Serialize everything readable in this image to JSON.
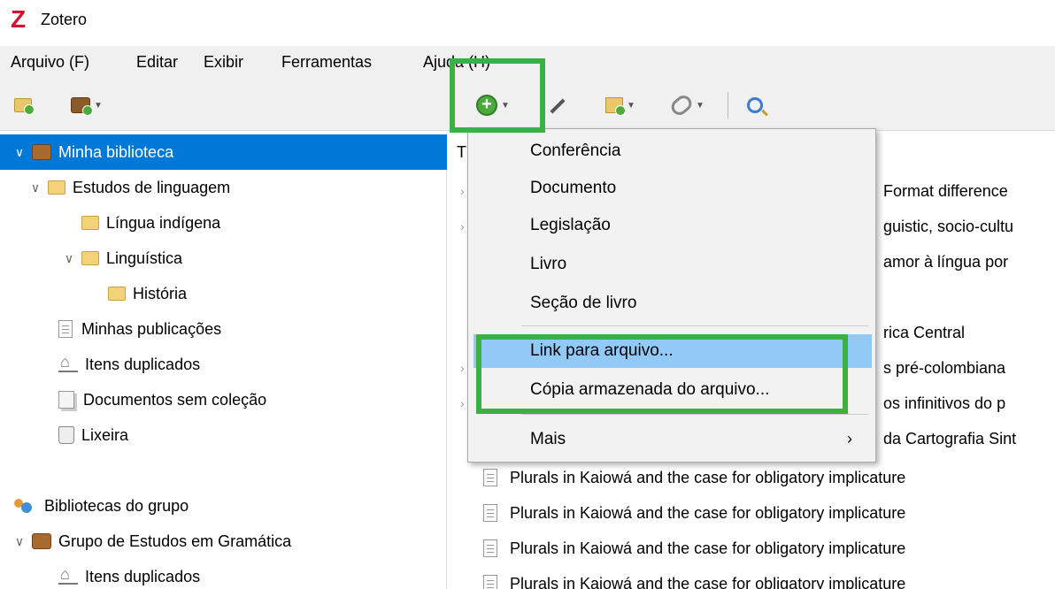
{
  "window": {
    "title": "Zotero",
    "logo": "Z"
  },
  "menubar": {
    "items": [
      "Arquivo (F)",
      "Editar",
      "Exibir",
      "Ferramentas",
      "Ajuda (H)"
    ]
  },
  "toolbar": {
    "buttons": [
      {
        "icon": "new-collection-icon"
      },
      {
        "icon": "new-library-icon"
      },
      {
        "icon": "new-item-icon"
      },
      {
        "icon": "add-by-identifier-icon"
      },
      {
        "icon": "new-note-icon"
      },
      {
        "icon": "add-attachment-icon"
      },
      {
        "icon": "search-icon"
      }
    ]
  },
  "tree": {
    "items": [
      {
        "label": "Minha biblioteca",
        "selected": true
      },
      {
        "label": "Estudos de linguagem"
      },
      {
        "label": "Língua indígena"
      },
      {
        "label": "Linguística"
      },
      {
        "label": "História"
      },
      {
        "label": "Minhas publicações"
      },
      {
        "label": "Itens duplicados"
      },
      {
        "label": "Documentos sem coleção"
      },
      {
        "label": "Lixeira"
      },
      {
        "label": "Bibliotecas do grupo"
      },
      {
        "label": "Grupo de Estudos em Gramática"
      },
      {
        "label": "Itens duplicados"
      }
    ]
  },
  "items_pane": {
    "header_partial": "T",
    "visible_fragments": [
      "Format difference",
      "guistic, socio-cultu",
      "amor à língua por",
      "rica Central",
      "s pré-colombiana",
      "os infinitivos do p",
      "da Cartografia Sint"
    ],
    "rows": [
      "Plurals in Kaiowá and the case for obligatory implicature",
      "Plurals in Kaiowá and the case for obligatory implicature",
      "Plurals in Kaiowá and the case for obligatory implicature",
      "Plurals in Kaiowá and the case for obligatory implicature"
    ]
  },
  "dropdown": {
    "items": [
      {
        "label": "Conferência"
      },
      {
        "label": "Documento"
      },
      {
        "label": "Legislação"
      },
      {
        "label": "Livro"
      },
      {
        "label": "Seção de livro"
      },
      {
        "label": "Link para arquivo..."
      },
      {
        "label": "Cópia armazenada do arquivo..."
      },
      {
        "label": "Mais",
        "submenu": true
      }
    ]
  },
  "colors": {
    "highlight": "#3cb043",
    "selection": "#0078d7",
    "menu_hover": "#91c9f7",
    "zotero_red": "#d3112e"
  }
}
